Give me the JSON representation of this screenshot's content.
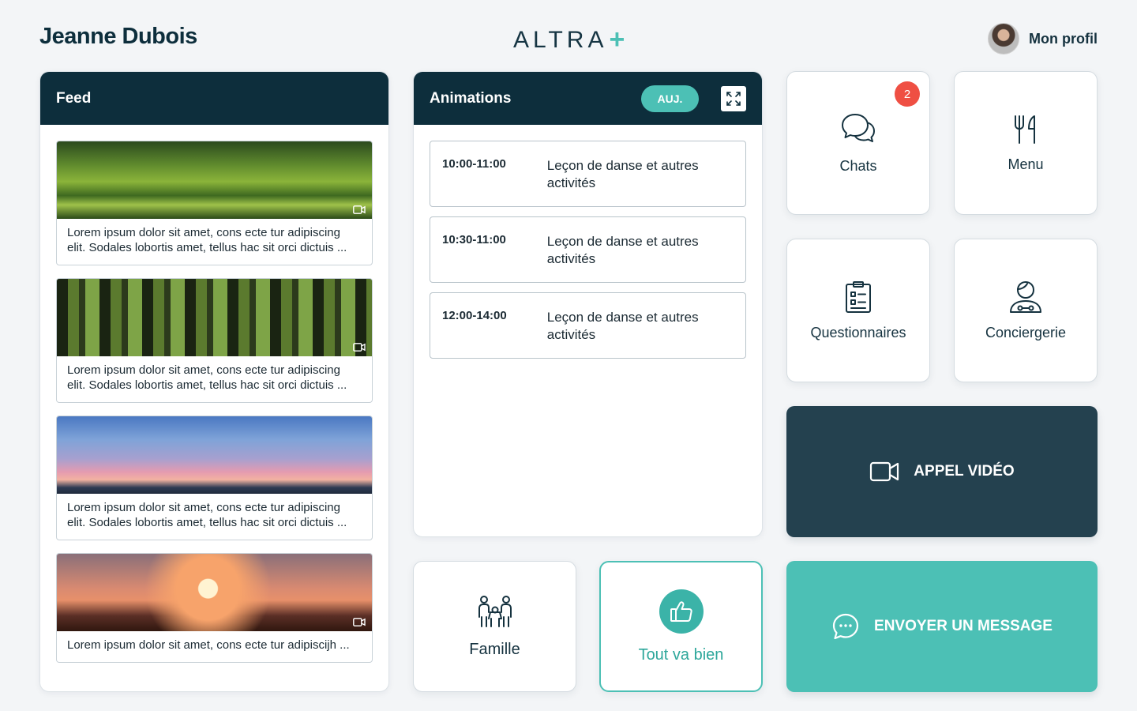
{
  "header": {
    "user_name": "Jeanne Dubois",
    "brand_text": "ALTRA",
    "brand_plus": "+",
    "profile_label": "Mon profil"
  },
  "colors": {
    "navy": "#0d2e3c",
    "teal": "#4cc0b5",
    "dark_slate": "#24414f",
    "badge_red": "#ef4f43"
  },
  "feed": {
    "title": "Feed",
    "items": [
      {
        "text": "Lorem ipsum dolor sit amet, cons ecte  tur adipiscing elit. Sodales lobortis amet, tellus hac sit orci dictuis ...",
        "icon": "video-icon"
      },
      {
        "text": "Lorem ipsum dolor sit amet, cons ecte  tur adipiscing elit. Sodales lobortis amet, tellus hac sit orci dictuis ...",
        "icon": "video-icon"
      },
      {
        "text": "Lorem ipsum dolor sit amet, cons ecte  tur adipiscing elit. Sodales lobortis amet, tellus hac sit orci dictuis ...",
        "icon": "none"
      },
      {
        "text": "Lorem ipsum dolor sit amet, cons ecte  tur adipiscijh ...",
        "icon": "video-icon"
      }
    ]
  },
  "animations": {
    "title": "Animations",
    "today_label": "AUJ.",
    "items": [
      {
        "time": "10:00-11:00",
        "title": "Leçon de danse et autres activités"
      },
      {
        "time": "10:30-11:00",
        "title": "Leçon de danse et autres activités"
      },
      {
        "time": "12:00-14:00",
        "title": "Leçon de danse et autres activités"
      }
    ]
  },
  "tiles": {
    "chats": {
      "label": "Chats",
      "badge": "2",
      "icon": "chat-bubbles-icon"
    },
    "menu": {
      "label": "Menu",
      "icon": "fork-knife-icon"
    },
    "questionnaires": {
      "label": "Questionnaires",
      "icon": "clipboard-icon"
    },
    "conciergerie": {
      "label": "Conciergerie",
      "icon": "concierge-icon"
    },
    "famille": {
      "label": "Famille",
      "icon": "family-icon"
    },
    "tout_va_bien": {
      "label": "Tout va bien",
      "icon": "thumbs-up-icon"
    }
  },
  "actions": {
    "video_call": "APPEL VIDÉO",
    "send_message": "ENVOYER UN MESSAGE"
  }
}
